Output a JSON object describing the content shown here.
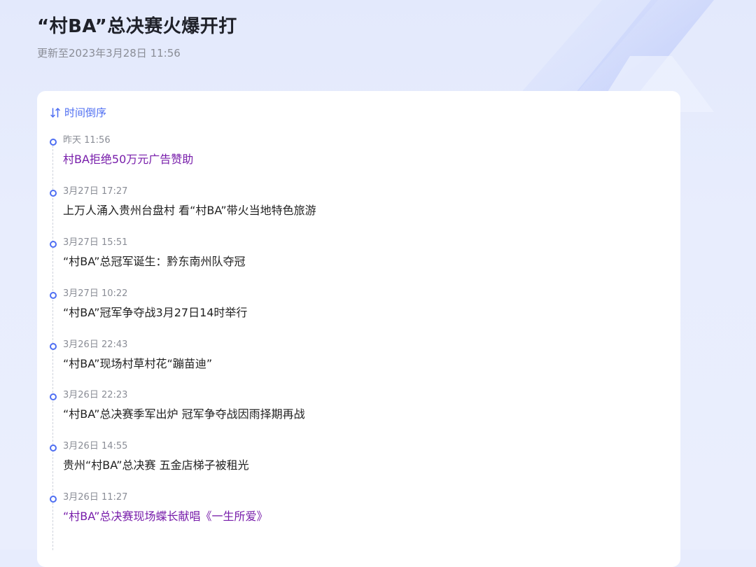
{
  "page": {
    "title": "“村BA”总决赛火爆开打",
    "update_time": "更新至2023年3月28日 11:56"
  },
  "sort": {
    "label": "时间倒序"
  },
  "colors": {
    "accent": "#4e6ef2",
    "visited_link": "#771caa",
    "text": "#222222",
    "muted": "#8a8d96"
  },
  "timeline": [
    {
      "time": "昨天 11:56",
      "headline": "村BA拒绝50万元广告赞助",
      "visited": true
    },
    {
      "time": "3月27日 17:27",
      "headline": "上万人涌入贵州台盘村 看“村BA”带火当地特色旅游",
      "visited": false
    },
    {
      "time": "3月27日 15:51",
      "headline": "“村BA”总冠军诞生：黔东南州队夺冠",
      "visited": false
    },
    {
      "time": "3月27日 10:22",
      "headline": "“村BA”冠军争夺战3月27日14时举行",
      "visited": false
    },
    {
      "time": "3月26日 22:43",
      "headline": "“村BA”现场村草村花“蹦苗迪”",
      "visited": false
    },
    {
      "time": "3月26日 22:23",
      "headline": "“村BA”总决赛季军出炉 冠军争夺战因雨择期再战",
      "visited": false
    },
    {
      "time": "3月26日 14:55",
      "headline": "贵州“村BA”总决赛 五金店梯子被租光",
      "visited": false
    },
    {
      "time": "3月26日 11:27",
      "headline": "“村BA”总决赛现场蝶长献唱《一生所爱》",
      "visited": true
    }
  ]
}
